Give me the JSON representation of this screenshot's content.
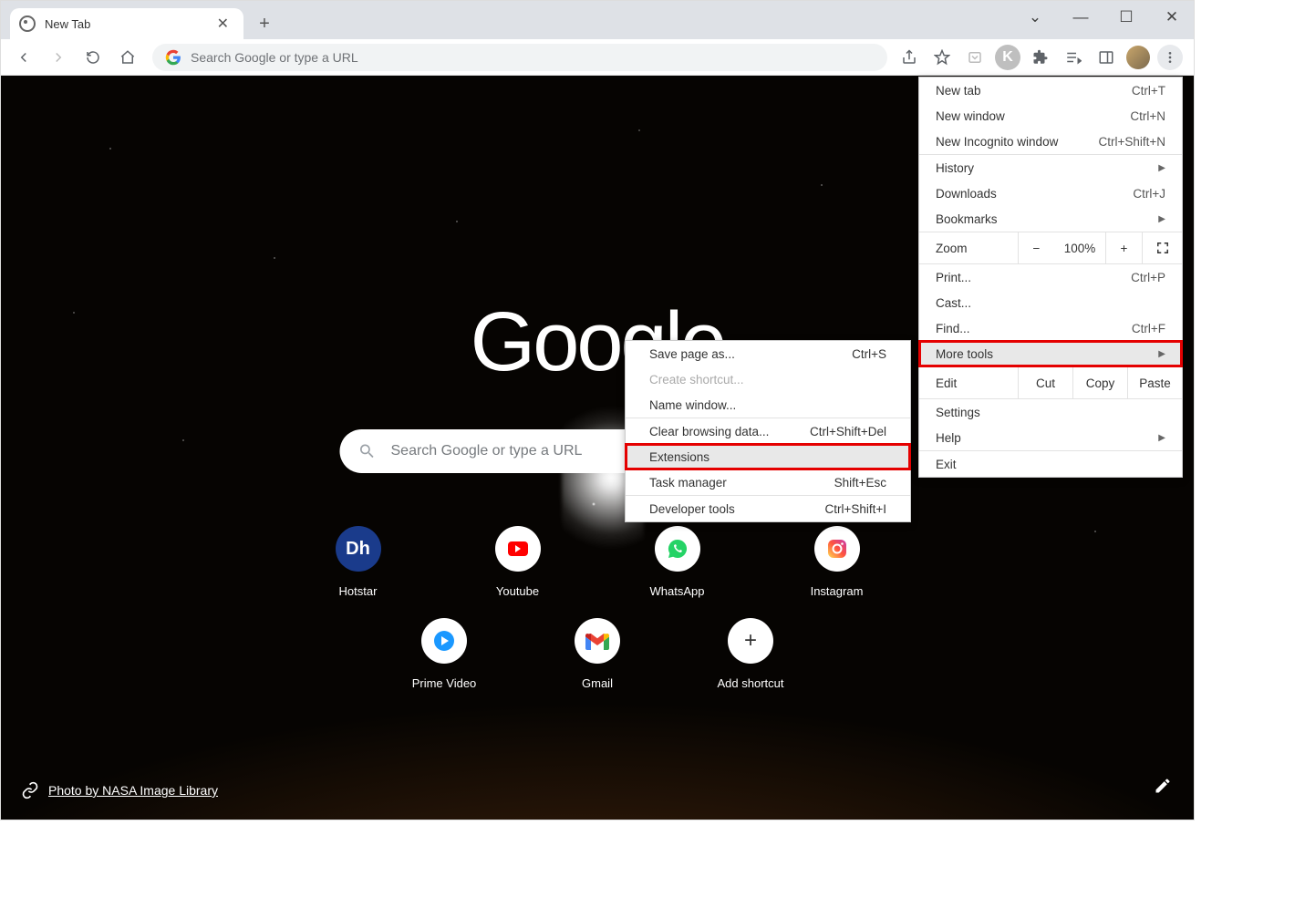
{
  "tab": {
    "title": "New Tab"
  },
  "omnibox": {
    "placeholder": "Search Google or type a URL"
  },
  "content": {
    "logo": "Google",
    "search_placeholder": "Search Google or type a URL",
    "shortcuts_row1": [
      {
        "label": "Hotstar"
      },
      {
        "label": "Youtube"
      },
      {
        "label": "WhatsApp"
      },
      {
        "label": "Instagram"
      }
    ],
    "shortcuts_row2": [
      {
        "label": "Prime Video"
      },
      {
        "label": "Gmail"
      },
      {
        "label": "Add shortcut"
      }
    ],
    "credit": "Photo by NASA Image Library"
  },
  "menu": {
    "new_tab": {
      "label": "New tab",
      "shortcut": "Ctrl+T"
    },
    "new_window": {
      "label": "New window",
      "shortcut": "Ctrl+N"
    },
    "incognito": {
      "label": "New Incognito window",
      "shortcut": "Ctrl+Shift+N"
    },
    "history": {
      "label": "History"
    },
    "downloads": {
      "label": "Downloads",
      "shortcut": "Ctrl+J"
    },
    "bookmarks": {
      "label": "Bookmarks"
    },
    "zoom": {
      "label": "Zoom",
      "value": "100%"
    },
    "print": {
      "label": "Print...",
      "shortcut": "Ctrl+P"
    },
    "cast": {
      "label": "Cast..."
    },
    "find": {
      "label": "Find...",
      "shortcut": "Ctrl+F"
    },
    "more_tools": {
      "label": "More tools"
    },
    "edit": {
      "label": "Edit",
      "cut": "Cut",
      "copy": "Copy",
      "paste": "Paste"
    },
    "settings": {
      "label": "Settings"
    },
    "help": {
      "label": "Help"
    },
    "exit": {
      "label": "Exit"
    }
  },
  "submenu": {
    "save_page": {
      "label": "Save page as...",
      "shortcut": "Ctrl+S"
    },
    "create_shortcut": {
      "label": "Create shortcut..."
    },
    "name_window": {
      "label": "Name window..."
    },
    "clear_data": {
      "label": "Clear browsing data...",
      "shortcut": "Ctrl+Shift+Del"
    },
    "extensions": {
      "label": "Extensions"
    },
    "task_manager": {
      "label": "Task manager",
      "shortcut": "Shift+Esc"
    },
    "dev_tools": {
      "label": "Developer tools",
      "shortcut": "Ctrl+Shift+I"
    }
  }
}
